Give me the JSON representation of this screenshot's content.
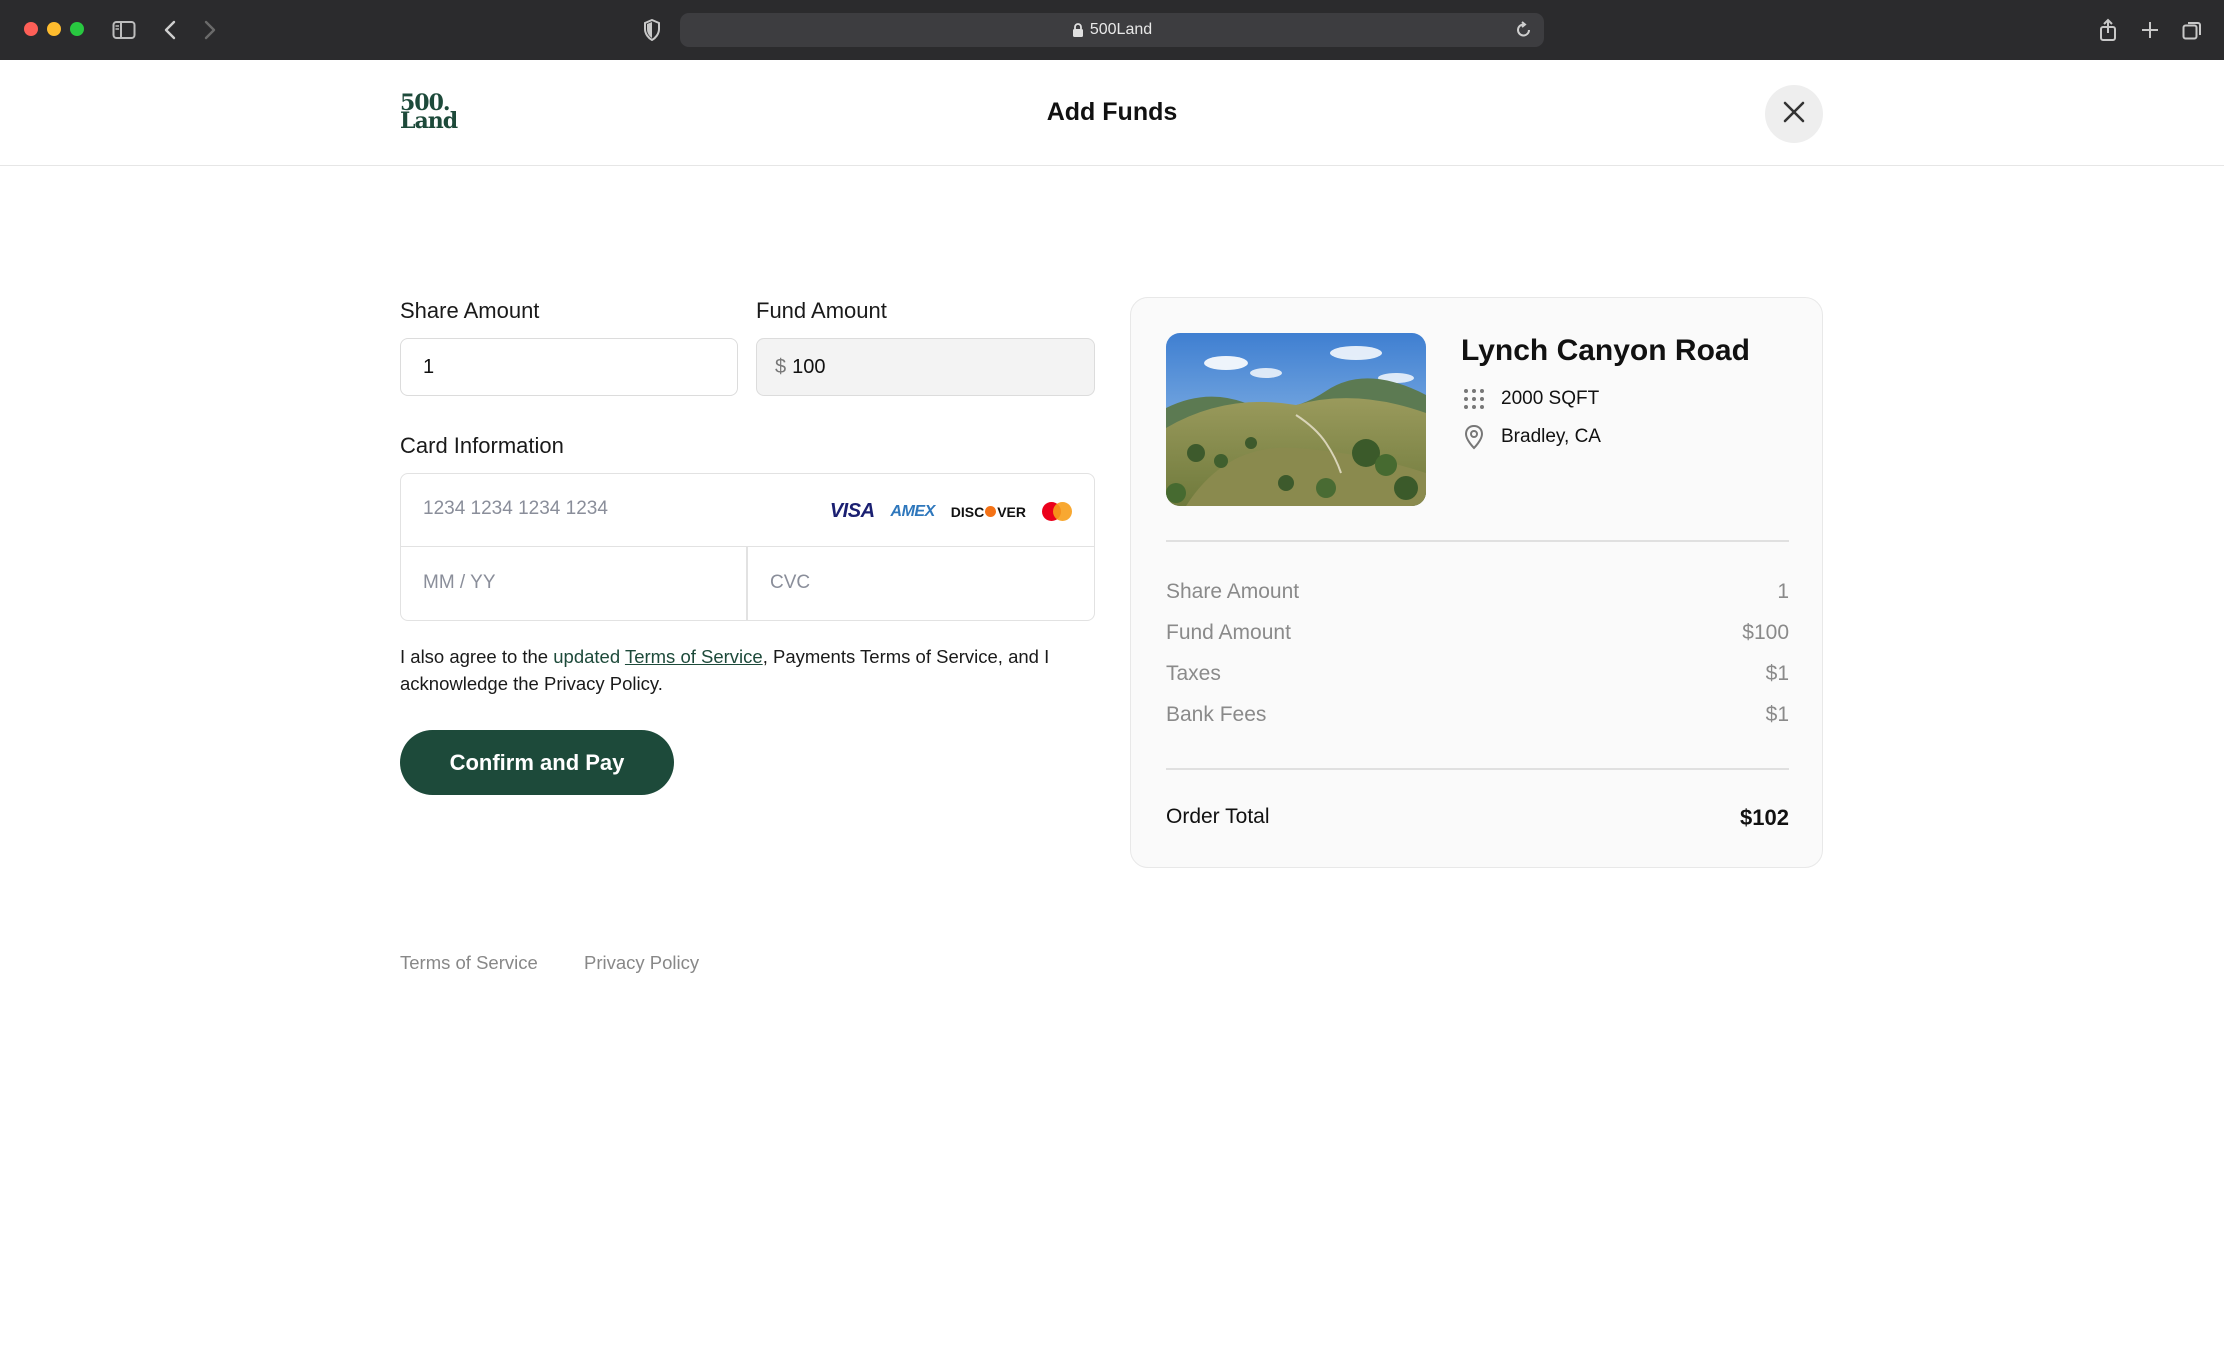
{
  "browser": {
    "url_text": "500Land"
  },
  "header": {
    "logo_line1": "500.",
    "logo_line2": "Land",
    "title": "Add Funds"
  },
  "form": {
    "share_label": "Share Amount",
    "share_value": "1",
    "fund_label": "Fund Amount",
    "fund_prefix": "$",
    "fund_value": "100",
    "card_label": "Card Information",
    "card_number_placeholder": "1234 1234 1234 1234",
    "expiry_placeholder": "MM / YY",
    "cvc_placeholder": "CVC",
    "brands": {
      "visa": "VISA",
      "amex": "AMEX",
      "discover_a": "DISC",
      "discover_b": "VER"
    },
    "agree": {
      "text1": "I also agree to the ",
      "updated": "updated",
      "space": " ",
      "tos_link": "Terms of Service",
      "text2": ", Payments Terms of Service, and I acknowledge the Privacy Policy."
    },
    "pay_button": "Confirm and Pay"
  },
  "summary": {
    "property_name": "Lynch Canyon Road",
    "area": "2000 SQFT",
    "location": "Bradley, CA",
    "rows": [
      {
        "label": "Share Amount",
        "value": "1"
      },
      {
        "label": "Fund Amount",
        "value": "$100"
      },
      {
        "label": "Taxes",
        "value": "$1"
      },
      {
        "label": "Bank Fees",
        "value": "$1"
      }
    ],
    "total_label": "Order Total",
    "total_value": "$102"
  },
  "footer": {
    "tos": "Terms of Service",
    "privacy": "Privacy Policy"
  },
  "colors": {
    "brand_green": "#1d4a3a",
    "chrome_bg": "#2b2b2d"
  },
  "icons": [
    "sidebar-icon",
    "back-icon",
    "forward-icon",
    "shield-icon",
    "lock-icon",
    "reload-icon",
    "share-icon",
    "new-tab-icon",
    "tabs-icon",
    "close-icon",
    "grid-icon",
    "location-pin-icon"
  ]
}
